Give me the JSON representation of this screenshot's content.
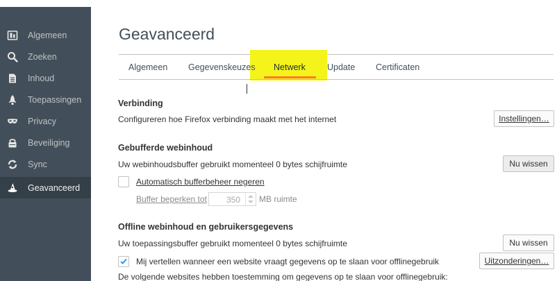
{
  "sidebar": {
    "items": [
      {
        "label": "Algemeen",
        "icon": "general-icon"
      },
      {
        "label": "Zoeken",
        "icon": "search-icon"
      },
      {
        "label": "Inhoud",
        "icon": "document-icon"
      },
      {
        "label": "Toepassingen",
        "icon": "rocket-icon"
      },
      {
        "label": "Privacy",
        "icon": "mask-icon"
      },
      {
        "label": "Beveiliging",
        "icon": "lock-icon"
      },
      {
        "label": "Sync",
        "icon": "sync-icon"
      },
      {
        "label": "Geavanceerd",
        "icon": "wizard-hat-icon",
        "active": true
      }
    ]
  },
  "main": {
    "title": "Geavanceerd",
    "tabs": [
      "Algemeen",
      "Gegevenskeuzes",
      "Netwerk",
      "Update",
      "Certificaten"
    ],
    "selected_tab": "Netwerk"
  },
  "connection": {
    "title": "Verbinding",
    "description": "Configureren hoe Firefox verbinding maakt met het internet",
    "settings_button": "Instellingen…"
  },
  "cache": {
    "title": "Gebufferde webinhoud",
    "description": "Uw webinhoudsbuffer gebruikt momenteel 0 bytes schijfruimte",
    "clear_button": "Nu wissen",
    "override_label": "Automatisch bufferbeheer negeren",
    "limit_label": "Buffer beperken tot",
    "limit_value": "350",
    "limit_unit": "MB ruimte"
  },
  "offline": {
    "title": "Offline webinhoud en gebruikersgegevens",
    "description": "Uw toepassingsbuffer gebruikt momenteel 0 bytes schijfruimte",
    "clear_button": "Nu wissen",
    "tell_me_label": "Mij vertellen wanneer een website vraagt gegevens op te slaan voor offlinegebruik",
    "tell_me_checked": true,
    "exceptions_button": "Uitzonderingen…",
    "allowed_text": "De volgende websites hebben toestemming om gegevens op te slaan voor offlinegebruik:"
  },
  "colors": {
    "sidebar_bg": "#424f5a",
    "sidebar_active_bg": "#343f48",
    "highlight": "#f4f41a",
    "tab_underline": "#ff7a2e",
    "check_accent": "#0996f8"
  }
}
